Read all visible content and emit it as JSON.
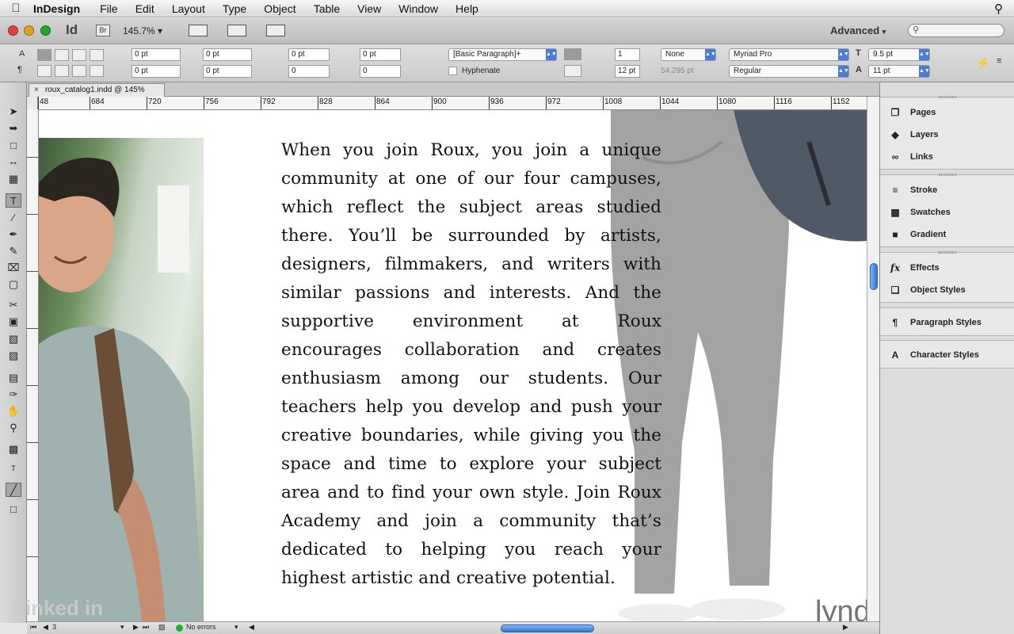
{
  "menubar": {
    "app": "InDesign",
    "items": [
      "File",
      "Edit",
      "Layout",
      "Type",
      "Object",
      "Table",
      "View",
      "Window",
      "Help"
    ]
  },
  "appbar": {
    "logo": "Id",
    "bridge": "Br",
    "zoom": "145.7%",
    "workspace": "Advanced"
  },
  "control": {
    "indent_left": "0 pt",
    "indent_first": "0 pt",
    "indent_right": "0 pt",
    "indent_last": "0 pt",
    "space_before": "0 pt",
    "space_after": "0 pt",
    "dropcap_lines": "0",
    "dropcap_chars": "0",
    "paragraph_style": "[Basic Paragraph]+",
    "hyphenate_label": "Hyphenate",
    "columns": "1",
    "gutter": "12 pt",
    "column_width": "54.295 pt",
    "fill": "None",
    "font_family": "Myriad Pro",
    "font_style": "Regular",
    "font_size": "9.5 pt",
    "leading": "11 pt"
  },
  "document": {
    "tab_title": "roux_catalog1.indd @ 145%",
    "ruler_labels": [
      "48",
      "684",
      "720",
      "756",
      "792",
      "828",
      "864",
      "900",
      "936",
      "972",
      "1008",
      "1044",
      "1080",
      "1116",
      "1152"
    ],
    "body_text": "When you join Roux, you join a unique community at one of our four campuses, which reflect the subject areas studied there. You’ll be surrounded by artists, designers, filmmakers, and writers with similar passions and interests. And the supportive environment at Roux encourages collaboration and creates enthusiasm among our students. Our teachers help you develop and push your creative boundaries, while giving you the space and time to explore your subject area and to find your own style. Join Roux Academy and join a community that’s dedicated to helping you reach your highest artistic and creative potential."
  },
  "status": {
    "page": "3",
    "preflight": "No errors"
  },
  "panels": {
    "group1": [
      "Pages",
      "Layers",
      "Links"
    ],
    "group2": [
      "Stroke",
      "Swatches",
      "Gradient"
    ],
    "group3": [
      "Effects",
      "Object Styles"
    ],
    "group4": [
      "Paragraph Styles"
    ],
    "group5": [
      "Character Styles"
    ]
  },
  "watermarks": {
    "lynda": "lynda.com",
    "linkedin": "Linked in"
  },
  "colors": {
    "accent_blue": "#2f74d6",
    "close_red": "#e0443e",
    "min_yellow": "#dea123",
    "max_green": "#1aab29"
  }
}
